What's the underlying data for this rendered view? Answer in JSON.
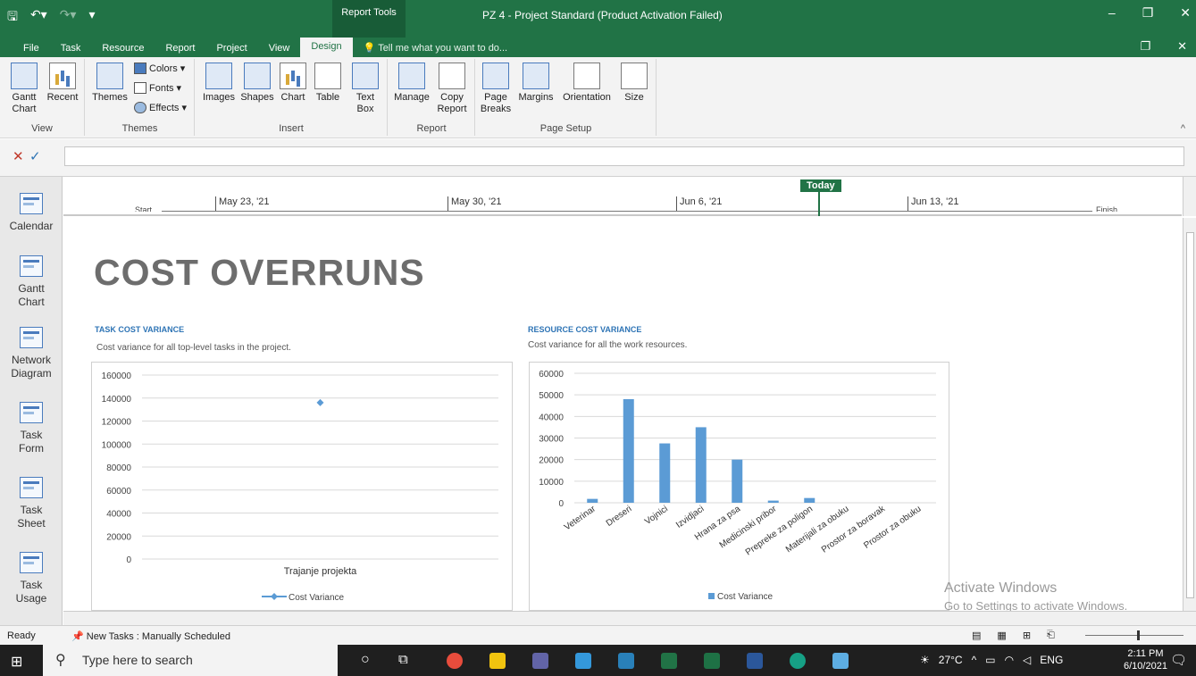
{
  "window": {
    "title": "PZ 4 - Project Standard (Product Activation Failed)",
    "contextual_tab": "Report Tools"
  },
  "tabs": [
    "File",
    "Task",
    "Resource",
    "Report",
    "Project",
    "View",
    "Design"
  ],
  "active_tab": "Design",
  "tell_me": "Tell me what you want to do...",
  "ribbon": {
    "view_group": {
      "label": "View",
      "gantt": "Gantt Chart",
      "recent": "Recent"
    },
    "themes_group": {
      "label": "Themes",
      "themes": "Themes",
      "colors": "Colors",
      "fonts": "Fonts",
      "effects": "Effects"
    },
    "insert_group": {
      "label": "Insert",
      "images": "Images",
      "shapes": "Shapes",
      "chart": "Chart",
      "table": "Table",
      "textbox": "Text Box"
    },
    "report_group": {
      "label": "Report",
      "manage": "Manage",
      "copy": "Copy Report"
    },
    "pagesetup_group": {
      "label": "Page Setup",
      "breaks": "Page Breaks",
      "margins": "Margins",
      "orientation": "Orientation",
      "size": "Size"
    }
  },
  "view_bar": [
    "Calendar",
    "Gantt Chart",
    "Network Diagram",
    "Task Form",
    "Task Sheet",
    "Task Usage"
  ],
  "timeline": {
    "today": "Today",
    "dates": [
      "May 23, '21",
      "May 30, '21",
      "Jun 6, '21",
      "Jun 13, '21"
    ],
    "start_label": "Start",
    "finish_label": "Finish"
  },
  "report": {
    "title": "COST OVERRUNS",
    "task_chart": {
      "heading": "TASK COST VARIANCE",
      "subtitle": "Cost variance for all top-level tasks in the project."
    },
    "resource_chart": {
      "heading": "RESOURCE COST VARIANCE",
      "subtitle": "Cost variance for all the work resources."
    }
  },
  "chart_data": [
    {
      "type": "line",
      "categories": [
        "Trajanje projekta"
      ],
      "series": [
        {
          "name": "Cost Variance",
          "values": [
            136000
          ]
        }
      ],
      "ylim": [
        0,
        160000
      ],
      "yticks": [
        0,
        20000,
        40000,
        60000,
        80000,
        100000,
        120000,
        140000,
        160000
      ],
      "grid": true,
      "legend": "bottom",
      "color": "#5b9bd5"
    },
    {
      "type": "bar",
      "categories": [
        "Veterinar",
        "Dreseri",
        "Vojnici",
        "Izvidjaci",
        "Hrana za psa",
        "Medicinski pribor",
        "Prepreke za poligon",
        "Materijali za obuku",
        "Prostor za boravak",
        "Prostor za obuku"
      ],
      "series": [
        {
          "name": "Cost Variance",
          "values": [
            1800,
            48000,
            27500,
            35000,
            20000,
            1000,
            2200,
            0,
            0,
            0
          ]
        }
      ],
      "ylim": [
        0,
        60000
      ],
      "yticks": [
        0,
        10000,
        20000,
        30000,
        40000,
        50000,
        60000
      ],
      "grid": true,
      "legend": "bottom",
      "color": "#5b9bd5"
    }
  ],
  "watermark": {
    "line1": "Activate Windows",
    "line2": "Go to Settings to activate Windows."
  },
  "status": {
    "ready": "Ready",
    "new_tasks": "New Tasks : Manually Scheduled"
  },
  "taskbar": {
    "search_placeholder": "Type here to search",
    "weather": "27°C",
    "lang": "ENG",
    "time": "2:11 PM",
    "date": "6/10/2021"
  }
}
